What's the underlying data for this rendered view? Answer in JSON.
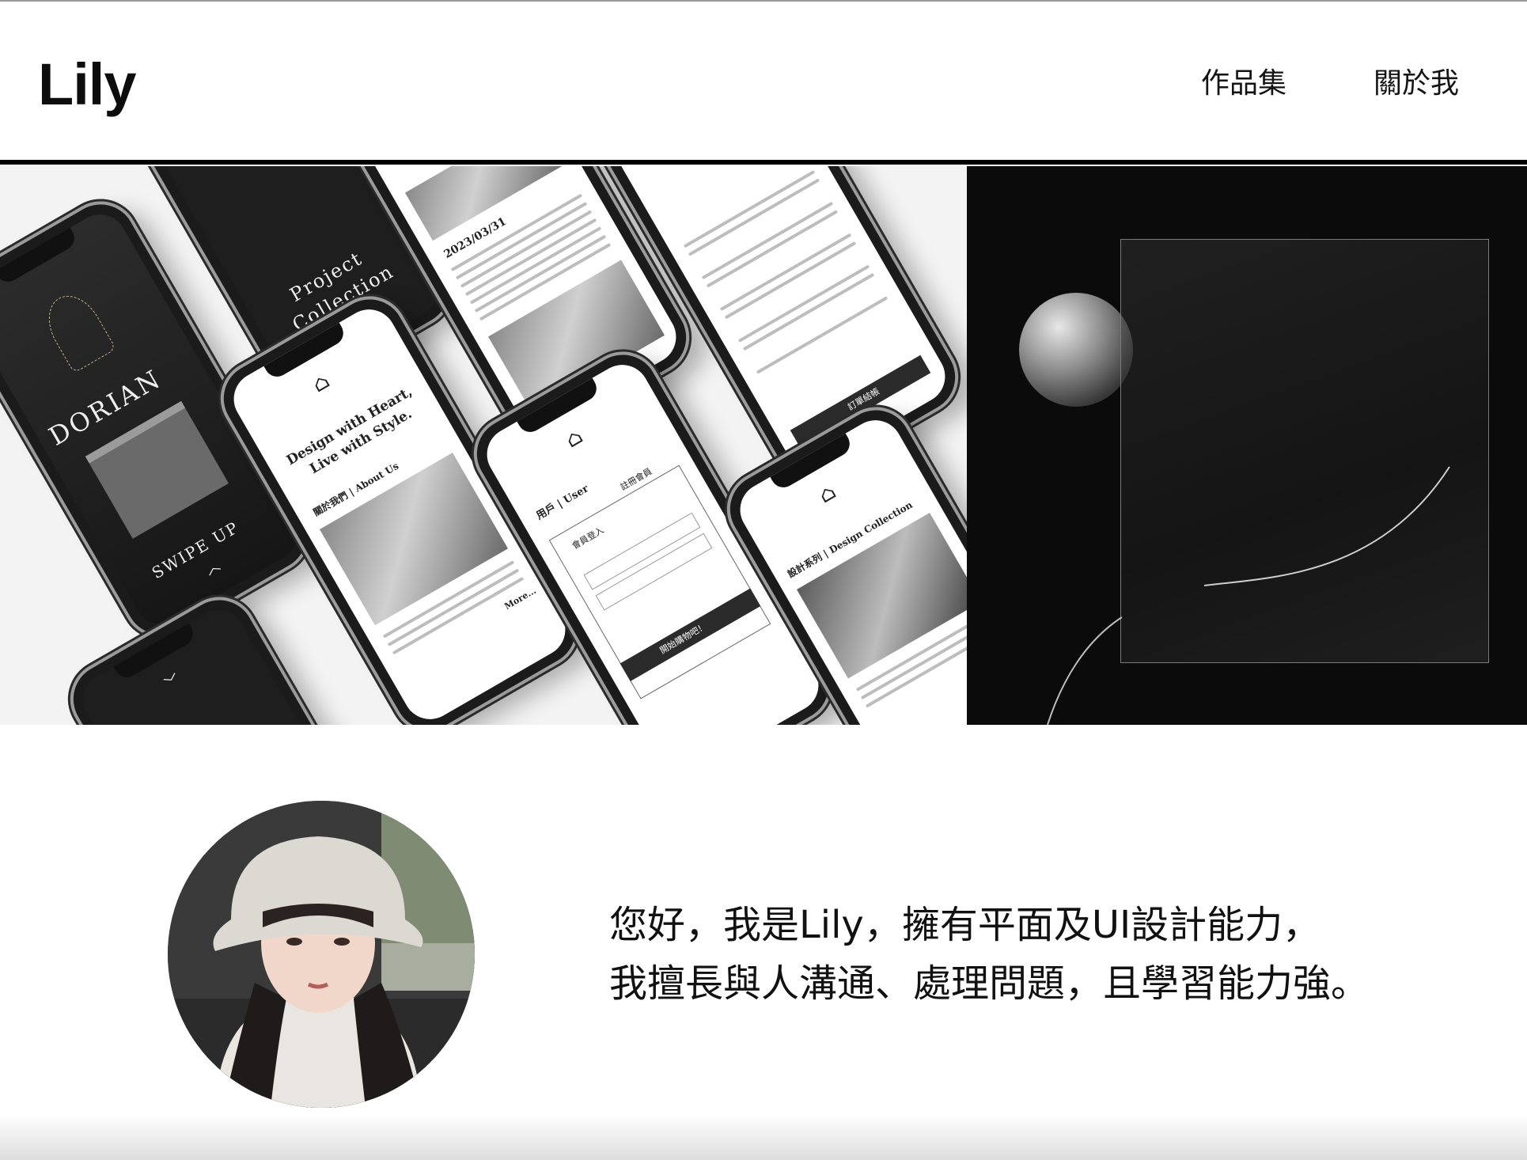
{
  "header": {
    "brand": "Lily",
    "nav": [
      {
        "label": "作品集"
      },
      {
        "label": "關於我"
      }
    ]
  },
  "hero": {
    "phones": {
      "dorian": {
        "brand": "DORIAN",
        "cta": "SWIPE UP"
      },
      "collection": {
        "line1": "Project",
        "line2": "Collection"
      },
      "article": {
        "date": "2023/03/31"
      },
      "home": {
        "headline1": "Design with Heart,",
        "headline2": "Live with Style.",
        "section": "關於我們 | About Us",
        "more": "More..."
      },
      "login": {
        "tab_user": "用戶 | User",
        "tab_register": "註冊會員",
        "login_label": "會員登入",
        "submit": "開始購物吧！"
      },
      "cart": {
        "checkout": "訂單結帳"
      },
      "design": {
        "section": "設計系列 | Design Collection"
      }
    }
  },
  "about": {
    "intro_line1": "您好，我是Lily，擁有平面及UI設計能力，",
    "intro_line2": "我擅長與人溝通、處理問題，且學習能力強。"
  }
}
